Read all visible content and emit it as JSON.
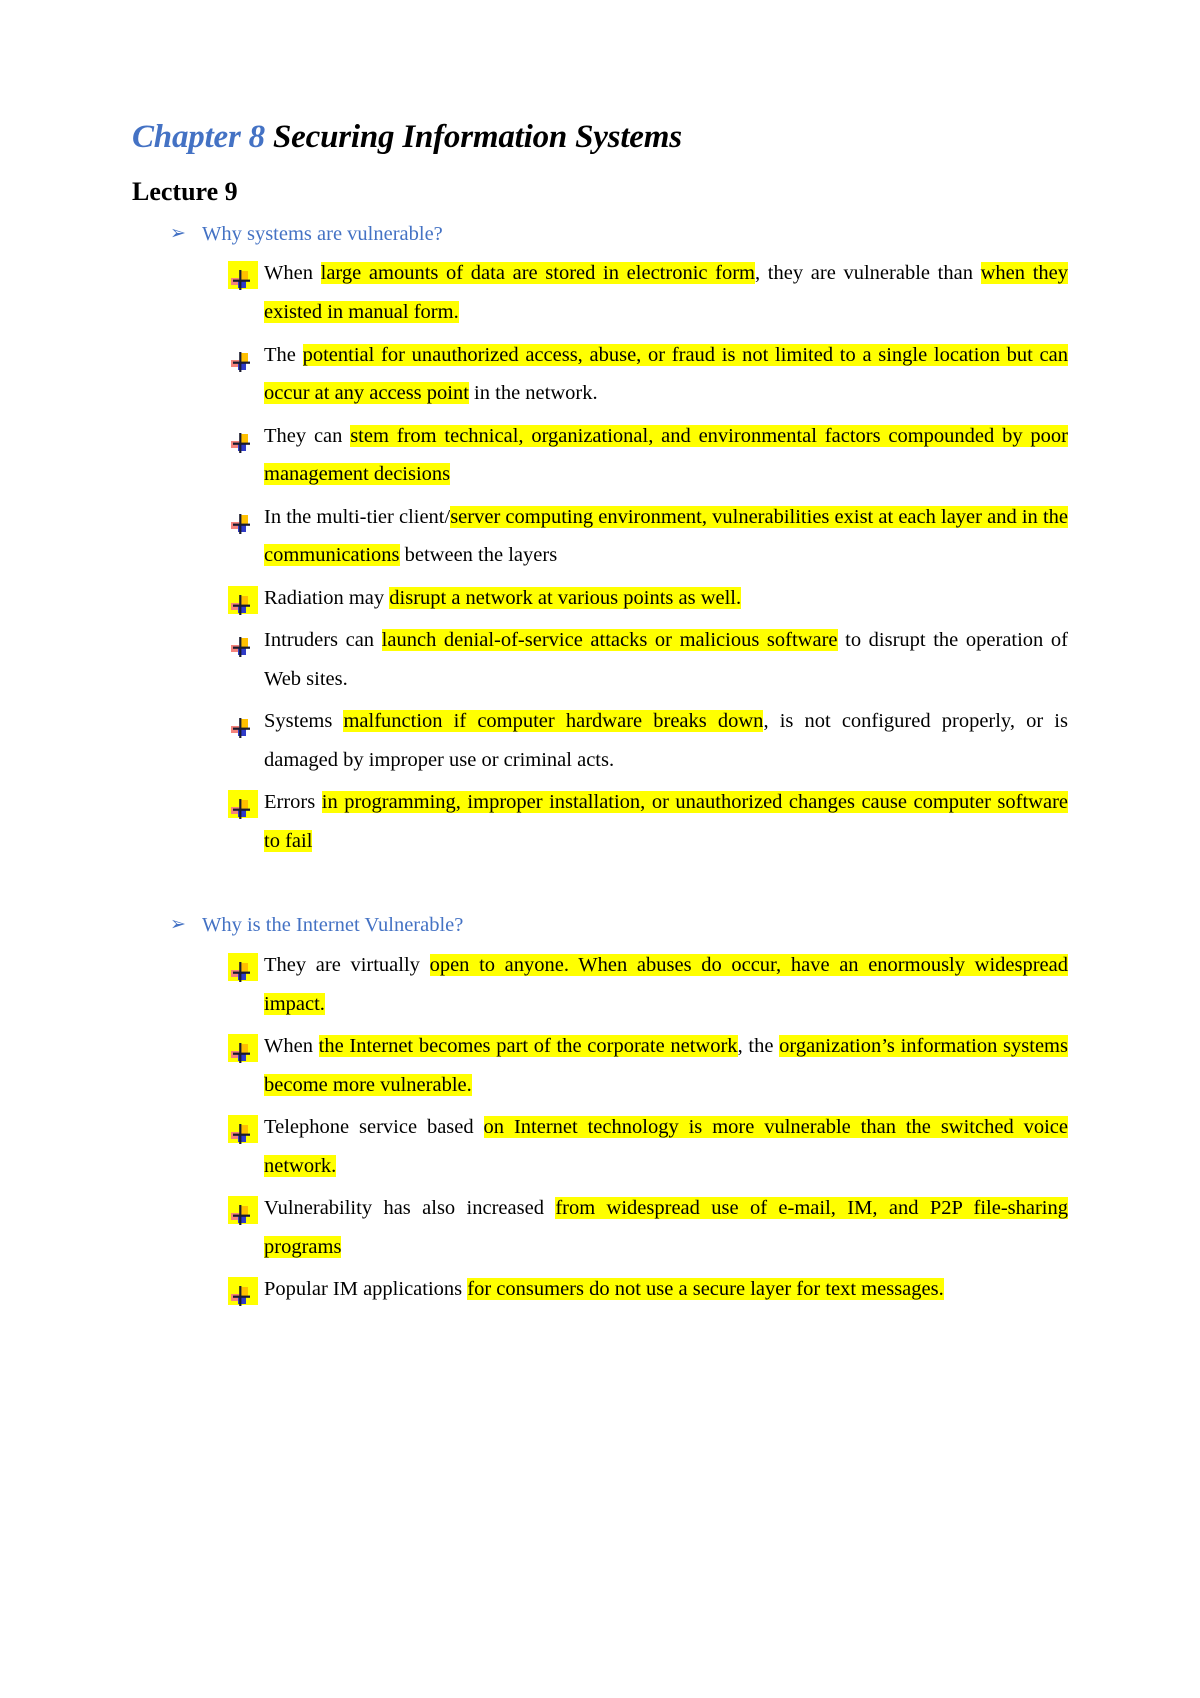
{
  "document": {
    "title": {
      "chapter": "Chapter 8",
      "subject": " Securing Information Systems"
    },
    "lecture_heading": "Lecture 9",
    "bullet_icon_name": "colored-cross-bullet",
    "arrow_icon": "➢",
    "colors": {
      "title_accent": "#4472C4",
      "section_header": "#4472C4",
      "highlight": "#FFFF00",
      "body_text": "#000000"
    }
  },
  "sections": [
    {
      "header": "Why systems are vulnerable?",
      "items": [
        {
          "marker_highlighted": true,
          "parts": [
            {
              "text": "When ",
              "hl": false
            },
            {
              "text": "large amounts of data are stored in electronic form",
              "hl": true
            },
            {
              "text": ", they are vulnerable than ",
              "hl": false
            },
            {
              "text": "when they existed in manual form.",
              "hl": true
            }
          ]
        },
        {
          "marker_highlighted": false,
          "parts": [
            {
              "text": "The ",
              "hl": false
            },
            {
              "text": "potential for unauthorized access, abuse, or fraud is not limited to a single location but can occur at any access point",
              "hl": true
            },
            {
              "text": " in the network.",
              "hl": false
            }
          ]
        },
        {
          "marker_highlighted": false,
          "parts": [
            {
              "text": "They   can   ",
              "hl": false
            },
            {
              "text": "stem   from    technical, organizational, and environmental factors compounded by poor management decisions",
              "hl": true
            }
          ]
        },
        {
          "marker_highlighted": false,
          "parts": [
            {
              "text": "In   the multi-tier client/",
              "hl": false
            },
            {
              "text": "server   computing environment, vulnerabilities exist at each layer and in the communications",
              "hl": true
            },
            {
              "text": " between the layers",
              "hl": false
            }
          ]
        },
        {
          "marker_highlighted": true,
          "parts": [
            {
              "text": "Radiation may ",
              "hl": false
            },
            {
              "text": "disrupt a network at various points as well.",
              "hl": true
            }
          ]
        },
        {
          "marker_highlighted": false,
          "parts": [
            {
              "text": "Intruders can ",
              "hl": false
            },
            {
              "text": "launch denial-of-service attacks or malicious software",
              "hl": true
            },
            {
              "text": " to disrupt the operation of Web sites.",
              "hl": false
            }
          ]
        },
        {
          "marker_highlighted": false,
          "parts": [
            {
              "text": "Systems    ",
              "hl": false
            },
            {
              "text": "malfunction if    computer    hardware    breaks    down",
              "hl": true
            },
            {
              "text": ", is   not configured properly, or is damaged by improper use or criminal acts.",
              "hl": false
            }
          ]
        },
        {
          "marker_highlighted": true,
          "parts": [
            {
              "text": "Errors ",
              "hl": false
            },
            {
              "text": "in programming,  improper  installation,  or  unauthorized  changes cause computer software to fail",
              "hl": true
            }
          ]
        }
      ]
    },
    {
      "header": "Why is the Internet Vulnerable?",
      "items": [
        {
          "marker_highlighted": true,
          "parts": [
            {
              "text": "They are virtually ",
              "hl": false
            },
            {
              "text": "open to anyone. When abuses do occur, have an enormously widespread impact.",
              "hl": true
            }
          ]
        },
        {
          "marker_highlighted": true,
          "parts": [
            {
              "text": "When    ",
              "hl": false
            },
            {
              "text": "the    Internet    becomes    part    of    the corporate    network",
              "hl": true
            },
            {
              "text": ", the ",
              "hl": false
            },
            {
              "text": "organization’s information systems become more vulnerable.",
              "hl": true
            }
          ]
        },
        {
          "marker_highlighted": true,
          "parts": [
            {
              "text": "Telephone   service   based   ",
              "hl": false
            },
            {
              "text": "on   Internet   technology is   more vulnerable than the switched voice network.",
              "hl": true
            }
          ]
        },
        {
          "marker_highlighted": true,
          "parts": [
            {
              "text": "Vulnerability has also increased ",
              "hl": false
            },
            {
              "text": "from widespread use of e-mail, IM, and P2P file-sharing programs",
              "hl": true
            }
          ]
        },
        {
          "marker_highlighted": true,
          "parts": [
            {
              "text": "Popular  IM  applications ",
              "hl": false
            },
            {
              "text": "for  consumers  do  not  use  a  secure  layer  for  text messages.",
              "hl": true
            }
          ]
        }
      ]
    }
  ]
}
